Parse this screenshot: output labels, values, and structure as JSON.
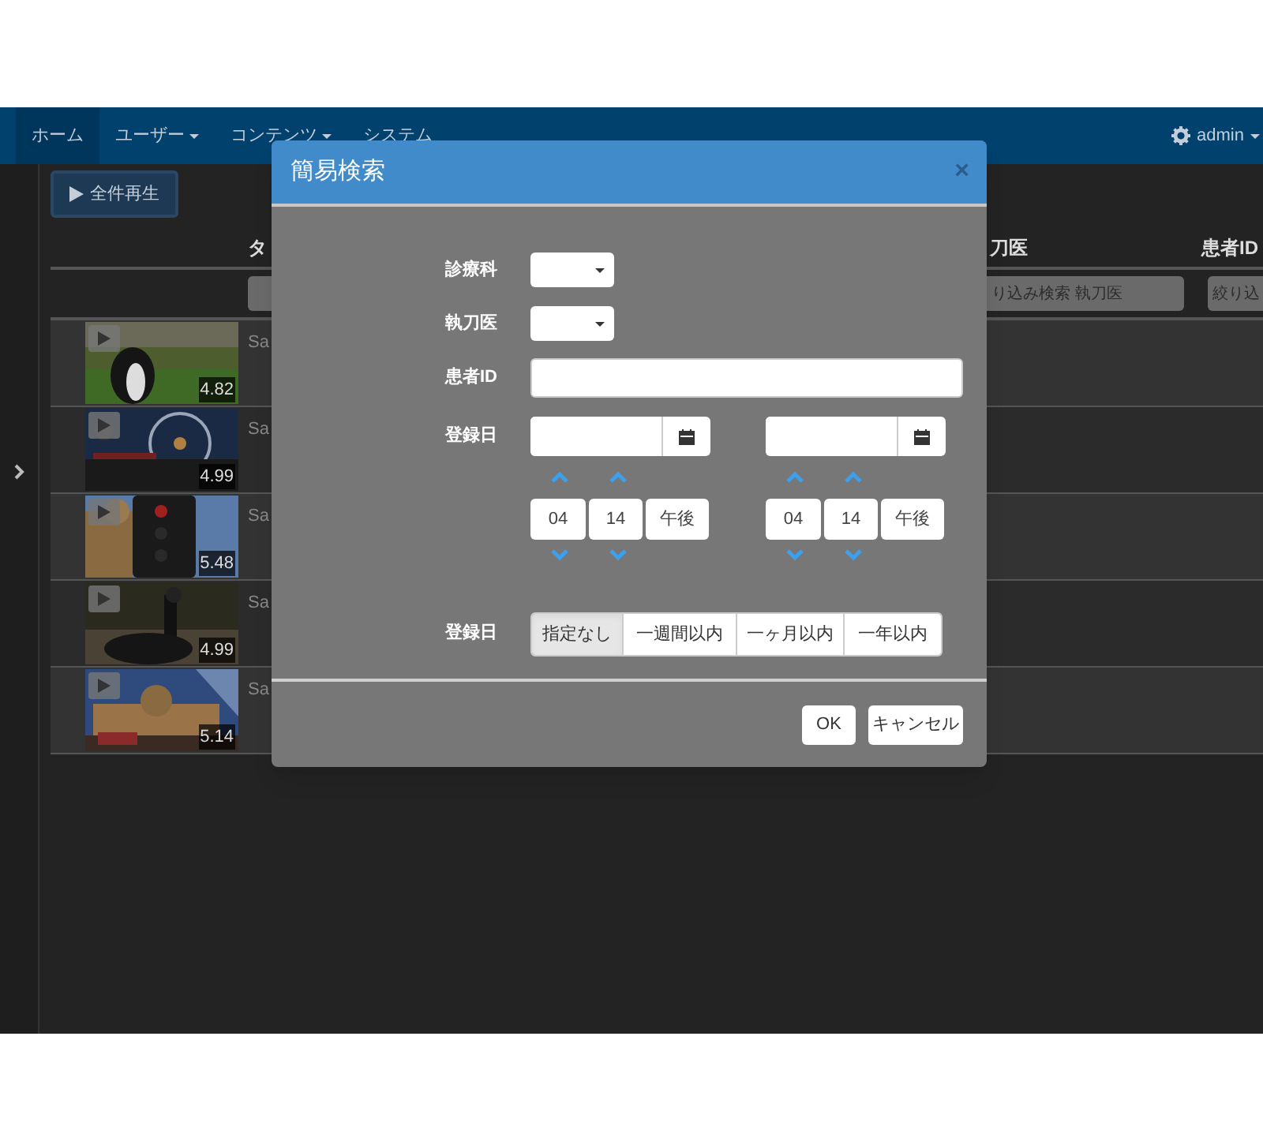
{
  "navbar": {
    "items": [
      {
        "label": "ホーム",
        "selected": true,
        "dropdown": false
      },
      {
        "label": "ユーザー",
        "selected": false,
        "dropdown": true
      },
      {
        "label": "コンテンツ",
        "selected": false,
        "dropdown": true
      },
      {
        "label": "システム",
        "selected": false,
        "dropdown": false
      }
    ],
    "user": {
      "label": "admin"
    }
  },
  "play_all_button": {
    "label": "全件再生"
  },
  "table": {
    "columns": [
      {
        "label": "タ"
      },
      {
        "label": "刀医"
      },
      {
        "label": "患者ID"
      }
    ],
    "filters": [
      {
        "placeholder": "り込み検索 執刀医"
      },
      {
        "placeholder": "絞り込"
      }
    ],
    "rows": [
      {
        "duration": "4.82",
        "title": "Sa"
      },
      {
        "duration": "4.99",
        "title": "Sa"
      },
      {
        "duration": "5.48",
        "title": "Sa"
      },
      {
        "duration": "4.99",
        "title": "Sa"
      },
      {
        "duration": "5.14",
        "title": "Sa"
      }
    ]
  },
  "modal": {
    "title": "簡易検索",
    "close": "×",
    "fields": [
      {
        "kind": "select",
        "label": "診療科"
      },
      {
        "kind": "select",
        "label": "執刀医"
      },
      {
        "kind": "text",
        "label": "患者ID"
      },
      {
        "kind": "daterange",
        "label": "登録日",
        "ranges": [
          {
            "hour": "04",
            "minute": "14",
            "period": "午後"
          },
          {
            "hour": "04",
            "minute": "14",
            "period": "午後"
          }
        ]
      },
      {
        "kind": "buttongroup",
        "label": "登録日",
        "options": [
          {
            "label": "指定なし",
            "selected": true
          },
          {
            "label": "一週間以内",
            "selected": false
          },
          {
            "label": "一ヶ月以内",
            "selected": false
          },
          {
            "label": "一年以内",
            "selected": false
          }
        ]
      }
    ],
    "buttons": [
      {
        "label": "OK"
      },
      {
        "label": "キャンセル"
      }
    ]
  }
}
